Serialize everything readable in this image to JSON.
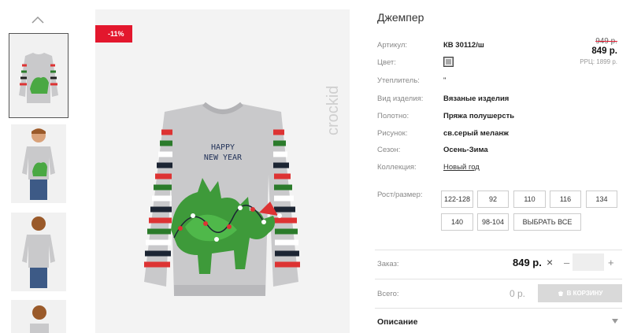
{
  "badge": "-11%",
  "brand": "crockid",
  "product": {
    "title": "Джемпер",
    "details": [
      {
        "label": "Артикул:",
        "value": "КВ 30112/ш"
      },
      {
        "label": "Цвет:",
        "value": ""
      },
      {
        "label": "Утеплитель:",
        "value": "\""
      },
      {
        "label": "Вид изделия:",
        "value": "Вязаные изделия"
      },
      {
        "label": "Полотно:",
        "value": "Пряжа полушерсть"
      },
      {
        "label": "Рисунок:",
        "value": "св.серый меланж"
      },
      {
        "label": "Сезон:",
        "value": "Осень-Зима"
      },
      {
        "label": "Коллекция:",
        "value": "Новый год"
      }
    ],
    "swatch_color": "#a9a9a9"
  },
  "price": {
    "old": "949 р.",
    "new": "849 р.",
    "rrp": "РРЦ: 1899 р."
  },
  "sizes": {
    "label": "Рост/размер:",
    "options": [
      "122-128",
      "92",
      "110",
      "116",
      "134",
      "140",
      "98-104"
    ],
    "select_all": "ВЫБРАТЬ ВСЕ"
  },
  "order": {
    "label": "Заказ:",
    "price": "849 р.",
    "x": "×",
    "minus": "–",
    "plus": "+",
    "quantity": ""
  },
  "total": {
    "label": "Всего:",
    "value": "0 р.",
    "cart_button": "В КОРЗИНУ"
  },
  "description": {
    "label": "Описание"
  },
  "sweater_text": {
    "line1": "HAPPY",
    "line2": "NEW YEAR"
  },
  "colors": {
    "accent": "#e3172d",
    "sweater_grey": "#c9c9cb",
    "dino_green": "#3e9a3a"
  }
}
